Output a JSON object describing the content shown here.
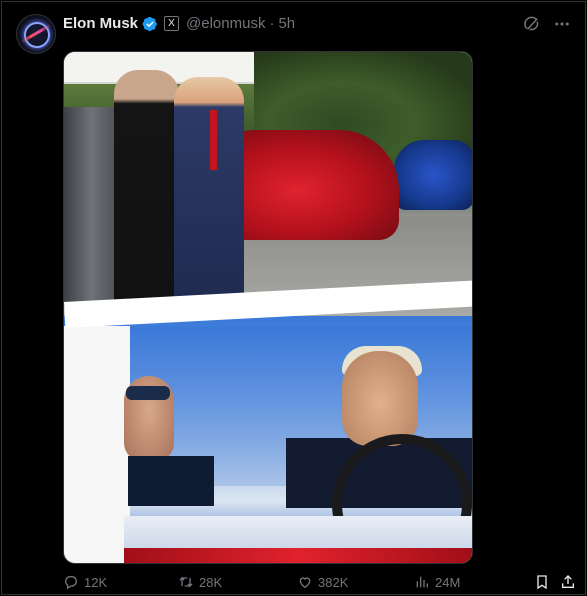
{
  "post": {
    "display_name": "Elon Musk",
    "verified_badge": "blue-check",
    "affiliate_badge": "X",
    "handle": "@elonmusk",
    "separator": "·",
    "timestamp": "5h"
  },
  "header_icons": {
    "grok": "grok-icon",
    "more": "more-icon"
  },
  "media": {
    "top_photo": "photo",
    "bottom_photo": "photo"
  },
  "actions": {
    "replies": "12K",
    "reposts": "28K",
    "likes": "382K",
    "views": "24M"
  },
  "colors": {
    "background": "#000000",
    "text_primary": "#e7e9ea",
    "text_secondary": "#71767b",
    "verified_blue": "#1d9bf0",
    "border": "#2f3336"
  }
}
